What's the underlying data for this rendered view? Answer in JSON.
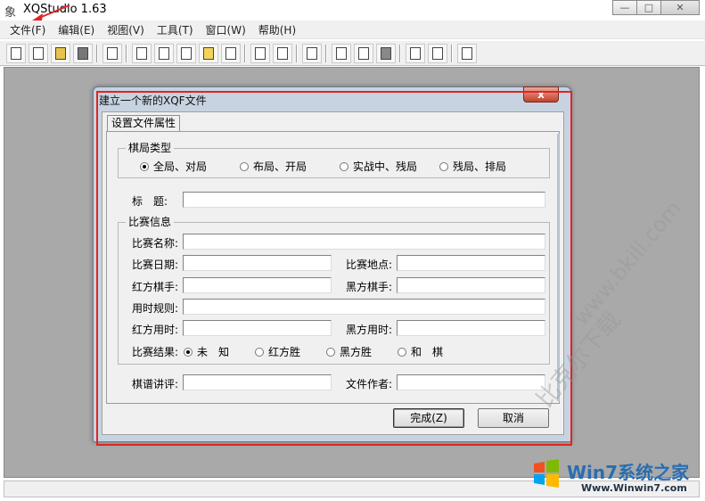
{
  "app": {
    "title": "XQStudio 1.63"
  },
  "window_controls": {
    "minimize": "—",
    "maximize": "□",
    "close": "✕"
  },
  "menu": [
    "文件(F)",
    "编辑(E)",
    "视图(V)",
    "工具(T)",
    "窗口(W)",
    "帮助(H)"
  ],
  "toolbar_icons": [
    "new-file-icon",
    "export-icon",
    "open-folder-icon",
    "stop-icon",
    "list-icon",
    "move-icon",
    "copy-icon",
    "open-icon",
    "save-icon",
    "grid-icon",
    "up-down-icon",
    "swap-icon",
    "branch-icon",
    "cut-icon",
    "copy2-icon",
    "paste-icon",
    "page-icon",
    "refresh-icon",
    "preview-icon"
  ],
  "dialog": {
    "title": "建立一个新的XQF文件",
    "close_glyph": "x",
    "tab": "设置文件属性",
    "game_type": {
      "title": "棋局类型",
      "options": [
        "全局、对局",
        "布局、开局",
        "实战中、残局",
        "残局、排局"
      ],
      "selected_index": 0
    },
    "title_label": "标　题:",
    "title_value": "",
    "match": {
      "title": "比赛信息",
      "name_label": "比赛名称:",
      "date_label": "比赛日期:",
      "place_label": "比赛地点:",
      "red_label": "红方棋手:",
      "black_label": "黑方棋手:",
      "time_rule_label": "用时规则:",
      "red_time_label": "红方用时:",
      "black_time_label": "黑方用时:",
      "result_label": "比赛结果:",
      "results": [
        "未　知",
        "红方胜",
        "黑方胜",
        "和　棋"
      ],
      "result_selected_index": 0
    },
    "commentary_label": "棋谱讲评:",
    "author_label": "文件作者:",
    "ok_button": "完成(Z)",
    "cancel_button": "取消"
  },
  "watermarks": {
    "bkill": "www.bkill.com",
    "bkill_cn": "比克尔下载",
    "win7_brand": "Win7系统之家",
    "win7_url": "Www.Winwin7.com"
  },
  "colors": {
    "annotation_red": "#e02424",
    "workspace": "#a9a9a9"
  }
}
